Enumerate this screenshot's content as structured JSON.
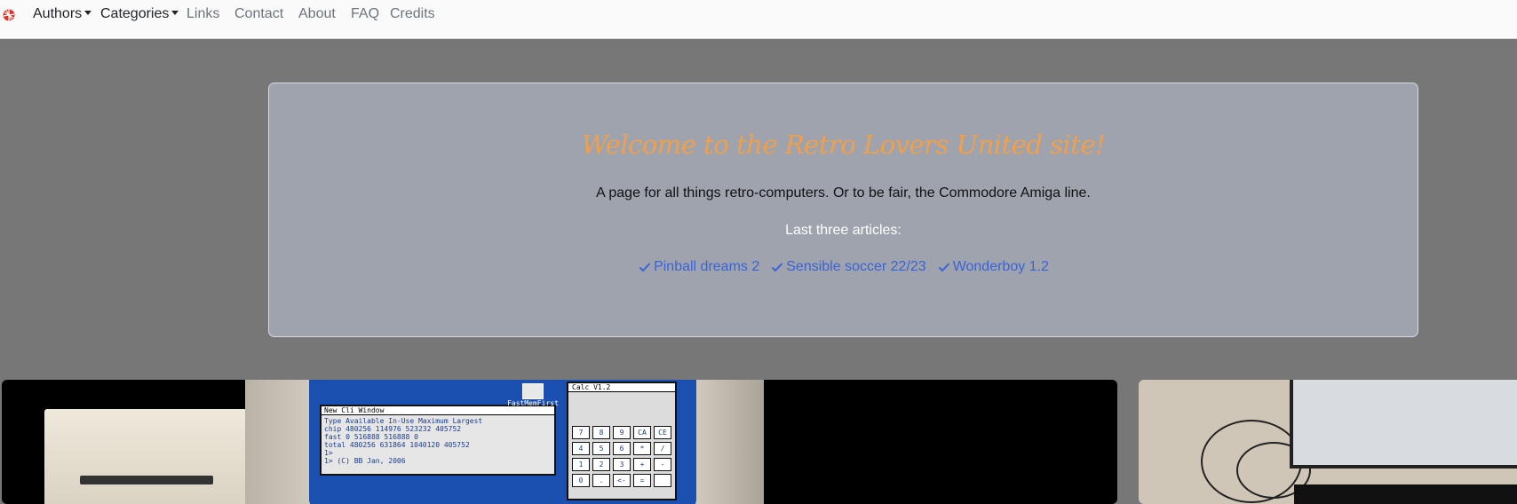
{
  "nav": {
    "logo_icon": "checkered-ball-icon",
    "items": [
      {
        "label": "Authors",
        "dropdown": true
      },
      {
        "label": "Categories",
        "dropdown": true
      },
      {
        "label": "Links",
        "dropdown": false
      },
      {
        "label": "Contact",
        "dropdown": false
      },
      {
        "label": "About",
        "dropdown": false
      },
      {
        "label": "FAQ",
        "dropdown": false
      },
      {
        "label": "Credits",
        "dropdown": false
      }
    ]
  },
  "hero": {
    "title": "Welcome to the Retro Lovers United site!",
    "subtitle": "A page for all things retro-computers. Or to be fair, the Commodore Amiga line.",
    "articles_label": "Last three articles:",
    "articles": [
      {
        "label": "Pinball dreams 2",
        "icon": "check-icon"
      },
      {
        "label": "Sensible soccer 22/23",
        "icon": "check-icon"
      },
      {
        "label": "Wonderboy 1.2",
        "icon": "check-icon"
      }
    ]
  },
  "cards": {
    "screen1": {
      "cli_title": "New Cli Window",
      "cli_lines": [
        "Type  Available  In-Use  Maximum  Largest",
        "chip     480256  114976   523232   405752",
        "fast          0  516888   516888        0",
        "total    480256  631864  1040120   405752",
        "1>",
        "1> (C) BB Jan, 2006"
      ],
      "fastmem_label": "FastMemFirst",
      "calc_title": "Calc V1.2",
      "calc_keys": [
        "7",
        "8",
        "9",
        "CA",
        "CE",
        "4",
        "5",
        "6",
        "*",
        "/",
        "1",
        "2",
        "3",
        "+",
        "-",
        "0",
        ".",
        "<-",
        "=",
        ""
      ]
    }
  },
  "colors": {
    "page_bg": "#777777",
    "hero_bg": "#9ea3ae",
    "title": "#f0a04b",
    "link": "#3b63d6"
  }
}
